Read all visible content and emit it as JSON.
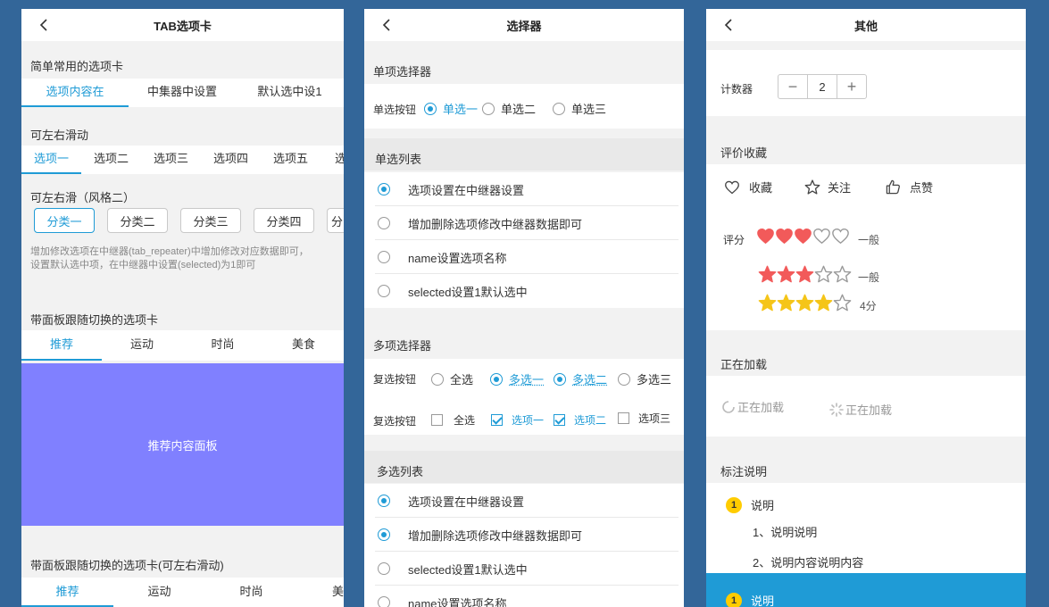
{
  "panel1": {
    "nav_title": "TAB选项卡",
    "simple": {
      "title": "简单常用的选项卡",
      "tabs": [
        "选项内容在",
        "中集器中设置",
        "默认选中设1"
      ]
    },
    "scroll": {
      "title": "可左右滑动",
      "tabs": [
        "选项一",
        "选项二",
        "选项三",
        "选项四",
        "选项五",
        "选"
      ]
    },
    "scroll2": {
      "title": "可左右滑（风格二）",
      "pills": [
        "分类一",
        "分类二",
        "分类三",
        "分类四",
        "分"
      ],
      "note_line1": "增加修改选项在中继器(tab_repeater)中增加修改对应数据即可，",
      "note_line2": "设置默认选中项，在中继器中设置(selected)为1即可"
    },
    "panel_tabs": {
      "title": "带面板跟随切换的选项卡",
      "tabs": [
        "推荐",
        "运动",
        "时尚",
        "美食"
      ],
      "panel_text": "推荐内容面板",
      "panel_color": "#8080ff"
    },
    "panel_tabs2": {
      "title": "带面板跟随切换的选项卡(可左右滑动)",
      "tabs": [
        "推荐",
        "运动",
        "时尚",
        "美"
      ]
    }
  },
  "panel2": {
    "nav_title": "选择器",
    "single": {
      "title": "单项选择器",
      "row_label": "单选按钮",
      "options": [
        "单选一",
        "单选二",
        "单选三"
      ]
    },
    "single_list": {
      "title": "单选列表",
      "items": [
        "选项设置在中继器设置",
        "增加删除选项修改中继器数据即可",
        "name设置选项名称",
        "selected设置1默认选中"
      ]
    },
    "multi": {
      "title": "多项选择器",
      "row1_label": "复选按钮",
      "row1_options": [
        "全选",
        "多选一",
        "多选二",
        "多选三"
      ],
      "row2_label": "复选按钮",
      "row2_options": [
        "全选",
        "选项一",
        "选项二",
        "选项三"
      ]
    },
    "multi_list": {
      "title": "多选列表",
      "items": [
        "选项设置在中继器设置",
        "增加删除选项修改中继器数据即可",
        "selected设置1默认选中",
        "name设置选项名称"
      ]
    }
  },
  "panel3": {
    "nav_title": "其他",
    "counter": {
      "label": "计数器",
      "value": "2",
      "minus": "−",
      "plus": "+"
    },
    "rating": {
      "title": "评价收藏",
      "actions": [
        "收藏",
        "关注",
        "点赞"
      ],
      "score_label": "评分",
      "hearts_value": 3,
      "hearts_max": 5,
      "hearts_text": "一般",
      "stars1_value": 3,
      "stars1_max": 5,
      "stars1_text": "一般",
      "stars2_value": 4,
      "stars2_max": 5,
      "stars2_text": "4分"
    },
    "loading": {
      "title": "正在加载",
      "text1": "正在加载",
      "text2": "正在加载"
    },
    "notes": {
      "title": "标注说明",
      "badge": "1",
      "head": "说明",
      "line1": "1、说明说明",
      "line2": "2、说明内容说明内容",
      "footer_head": "说明"
    }
  },
  "colors": {
    "accent": "#1f9bd6",
    "heart": "#f25a5a",
    "star": "#f5c518",
    "background": "#336699"
  }
}
